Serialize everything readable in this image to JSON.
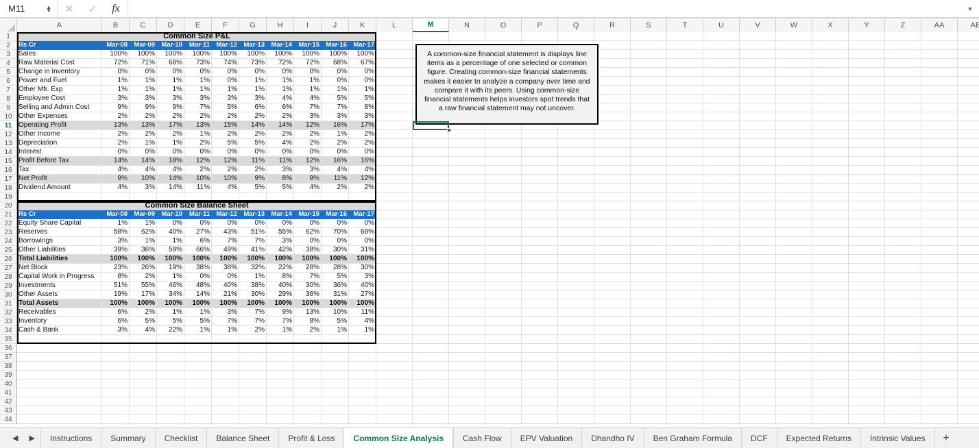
{
  "formula_bar": {
    "name_box": "M11",
    "cancel_icon": "close-icon",
    "confirm_icon": "check-icon",
    "fx_label": "fx",
    "formula_value": "",
    "expand_icon": "chevron-down-icon"
  },
  "grid": {
    "columns": [
      "A",
      "B",
      "C",
      "D",
      "E",
      "F",
      "G",
      "H",
      "I",
      "J",
      "K",
      "L",
      "M",
      "N",
      "O",
      "P",
      "Q",
      "R",
      "S",
      "T",
      "U",
      "V",
      "W",
      "X",
      "Y",
      "Z",
      "AA",
      "AB"
    ],
    "active_column": "M",
    "active_row": 11,
    "active_cell": "M11",
    "row_count": 44,
    "accent_color": "#0a7a45",
    "header_blue": "#1f6fc4",
    "total_gray": "#d9d9d9"
  },
  "pnl": {
    "title": "Common Size P&L",
    "title_row": 1,
    "header_row": 2,
    "corner_label": "Rs Cr",
    "periods": [
      "Mar-08",
      "Mar-09",
      "Mar-10",
      "Mar-11",
      "Mar-12",
      "Mar-13",
      "Mar-14",
      "Mar-15",
      "Mar-16",
      "Mar-17"
    ],
    "rows": [
      {
        "row": 3,
        "label": "Sales",
        "style": "normal",
        "values": [
          "100%",
          "100%",
          "100%",
          "100%",
          "100%",
          "100%",
          "100%",
          "100%",
          "100%",
          "100%"
        ]
      },
      {
        "row": 4,
        "label": "Raw Material Cost",
        "style": "normal",
        "values": [
          "72%",
          "71%",
          "68%",
          "73%",
          "74%",
          "73%",
          "72%",
          "72%",
          "68%",
          "67%"
        ]
      },
      {
        "row": 5,
        "label": "Change in Inventory",
        "style": "normal",
        "values": [
          "0%",
          "0%",
          "0%",
          "0%",
          "0%",
          "0%",
          "0%",
          "0%",
          "0%",
          "0%"
        ]
      },
      {
        "row": 6,
        "label": "Power and Fuel",
        "style": "normal",
        "values": [
          "1%",
          "1%",
          "1%",
          "1%",
          "0%",
          "1%",
          "1%",
          "1%",
          "0%",
          "0%"
        ]
      },
      {
        "row": 7,
        "label": "Other Mfr. Exp",
        "style": "normal",
        "values": [
          "1%",
          "1%",
          "1%",
          "1%",
          "1%",
          "1%",
          "1%",
          "1%",
          "1%",
          "1%"
        ]
      },
      {
        "row": 8,
        "label": "Employee Cost",
        "style": "normal",
        "values": [
          "3%",
          "3%",
          "3%",
          "3%",
          "3%",
          "3%",
          "4%",
          "4%",
          "5%",
          "5%"
        ]
      },
      {
        "row": 9,
        "label": "Selling and Admin Cost",
        "style": "normal",
        "values": [
          "9%",
          "9%",
          "9%",
          "7%",
          "5%",
          "6%",
          "6%",
          "7%",
          "7%",
          "8%"
        ]
      },
      {
        "row": 10,
        "label": "Other Expenses",
        "style": "normal",
        "values": [
          "2%",
          "2%",
          "2%",
          "2%",
          "2%",
          "2%",
          "2%",
          "3%",
          "3%",
          "3%"
        ]
      },
      {
        "row": 11,
        "label": "Operating Profit",
        "style": "sub",
        "values": [
          "13%",
          "13%",
          "17%",
          "13%",
          "15%",
          "14%",
          "14%",
          "12%",
          "16%",
          "17%"
        ]
      },
      {
        "row": 12,
        "label": "Other Income",
        "style": "normal",
        "values": [
          "2%",
          "2%",
          "2%",
          "1%",
          "2%",
          "2%",
          "2%",
          "2%",
          "1%",
          "2%"
        ]
      },
      {
        "row": 13,
        "label": "Depreciation",
        "style": "normal",
        "values": [
          "2%",
          "1%",
          "1%",
          "2%",
          "5%",
          "5%",
          "4%",
          "2%",
          "2%",
          "2%"
        ]
      },
      {
        "row": 14,
        "label": "Interest",
        "style": "normal",
        "values": [
          "0%",
          "0%",
          "0%",
          "0%",
          "0%",
          "0%",
          "0%",
          "0%",
          "0%",
          "0%"
        ]
      },
      {
        "row": 15,
        "label": "Profit Before Tax",
        "style": "sub",
        "values": [
          "14%",
          "14%",
          "18%",
          "12%",
          "12%",
          "11%",
          "11%",
          "12%",
          "16%",
          "16%"
        ]
      },
      {
        "row": 16,
        "label": "Tax",
        "style": "normal",
        "values": [
          "4%",
          "4%",
          "4%",
          "2%",
          "2%",
          "2%",
          "3%",
          "3%",
          "4%",
          "4%"
        ]
      },
      {
        "row": 17,
        "label": "Net Profit",
        "style": "sub",
        "values": [
          "9%",
          "10%",
          "14%",
          "10%",
          "10%",
          "9%",
          "8%",
          "9%",
          "11%",
          "12%"
        ]
      },
      {
        "row": 18,
        "label": "Dividend Amount",
        "style": "normal",
        "values": [
          "4%",
          "3%",
          "14%",
          "11%",
          "4%",
          "5%",
          "5%",
          "4%",
          "2%",
          "2%"
        ]
      }
    ]
  },
  "balance_sheet": {
    "title": "Common Size Balance Sheet",
    "title_row": 20,
    "header_row": 21,
    "corner_label": "Rs Cr",
    "periods": [
      "Mar-08",
      "Mar-09",
      "Mar-10",
      "Mar-11",
      "Mar-12",
      "Mar-13",
      "Mar-14",
      "Mar-15",
      "Mar-16",
      "Mar-17"
    ],
    "rows": [
      {
        "row": 22,
        "label": "Equity Share Capital",
        "style": "normal",
        "values": [
          "1%",
          "1%",
          "0%",
          "0%",
          "0%",
          "0%",
          "0%",
          "0%",
          "0%",
          "0%"
        ]
      },
      {
        "row": 23,
        "label": "Reserves",
        "style": "normal",
        "values": [
          "58%",
          "62%",
          "40%",
          "27%",
          "43%",
          "51%",
          "55%",
          "62%",
          "70%",
          "68%"
        ]
      },
      {
        "row": 24,
        "label": "Borrowings",
        "style": "normal",
        "values": [
          "3%",
          "1%",
          "1%",
          "6%",
          "7%",
          "7%",
          "3%",
          "0%",
          "0%",
          "0%"
        ]
      },
      {
        "row": 25,
        "label": "Other Liabilities",
        "style": "normal",
        "values": [
          "39%",
          "36%",
          "59%",
          "66%",
          "49%",
          "41%",
          "42%",
          "38%",
          "30%",
          "31%"
        ]
      },
      {
        "row": 26,
        "label": "Total Liabilities",
        "style": "total",
        "values": [
          "100%",
          "100%",
          "100%",
          "100%",
          "100%",
          "100%",
          "100%",
          "100%",
          "100%",
          "100%"
        ]
      },
      {
        "row": 27,
        "label": "Net Block",
        "style": "normal",
        "values": [
          "23%",
          "26%",
          "19%",
          "38%",
          "38%",
          "32%",
          "22%",
          "28%",
          "28%",
          "30%"
        ]
      },
      {
        "row": 28,
        "label": "Capital Work in Progress",
        "style": "normal",
        "values": [
          "8%",
          "2%",
          "1%",
          "0%",
          "0%",
          "1%",
          "8%",
          "7%",
          "5%",
          "3%"
        ]
      },
      {
        "row": 29,
        "label": "Investments",
        "style": "normal",
        "values": [
          "51%",
          "55%",
          "46%",
          "48%",
          "40%",
          "38%",
          "40%",
          "30%",
          "36%",
          "40%"
        ]
      },
      {
        "row": 30,
        "label": "Other Assets",
        "style": "normal",
        "values": [
          "19%",
          "17%",
          "34%",
          "14%",
          "21%",
          "30%",
          "29%",
          "36%",
          "31%",
          "27%"
        ]
      },
      {
        "row": 31,
        "label": "Total Assets",
        "style": "total",
        "values": [
          "100%",
          "100%",
          "100%",
          "100%",
          "100%",
          "100%",
          "100%",
          "100%",
          "100%",
          "100%"
        ]
      },
      {
        "row": 32,
        "label": "Receivables",
        "style": "normal",
        "values": [
          "6%",
          "2%",
          "1%",
          "1%",
          "3%",
          "7%",
          "9%",
          "13%",
          "10%",
          "11%"
        ]
      },
      {
        "row": 33,
        "label": "Inventory",
        "style": "normal",
        "values": [
          "6%",
          "5%",
          "5%",
          "5%",
          "7%",
          "7%",
          "7%",
          "8%",
          "5%",
          "4%"
        ]
      },
      {
        "row": 34,
        "label": "Cash & Bank",
        "style": "normal",
        "values": [
          "3%",
          "4%",
          "22%",
          "1%",
          "1%",
          "2%",
          "1%",
          "2%",
          "1%",
          "1%"
        ]
      }
    ]
  },
  "textbox": {
    "text": "A common-size financial statement is displays line items as a percentage of one selected or common figure. Creating common-size financial statements makes it easier to analyze a company over time and compare it with its peers. Using common-size financial statements helps investors spot trends that a raw financial statement may not uncover."
  },
  "sheet_tabs": {
    "prev_icon": "arrow-left-icon",
    "next_icon": "arrow-right-icon",
    "add_label": "+",
    "active": "Common Size Analysis",
    "tabs": [
      "Instructions",
      "Summary",
      "Checklist",
      "Balance Sheet",
      "Profit & Loss",
      "Common Size Analysis",
      "Cash Flow",
      "EPV Valuation",
      "Dhandho IV",
      "Ben Graham Formula",
      "DCF",
      "Expected Returns",
      "Intrinsic Values"
    ]
  }
}
